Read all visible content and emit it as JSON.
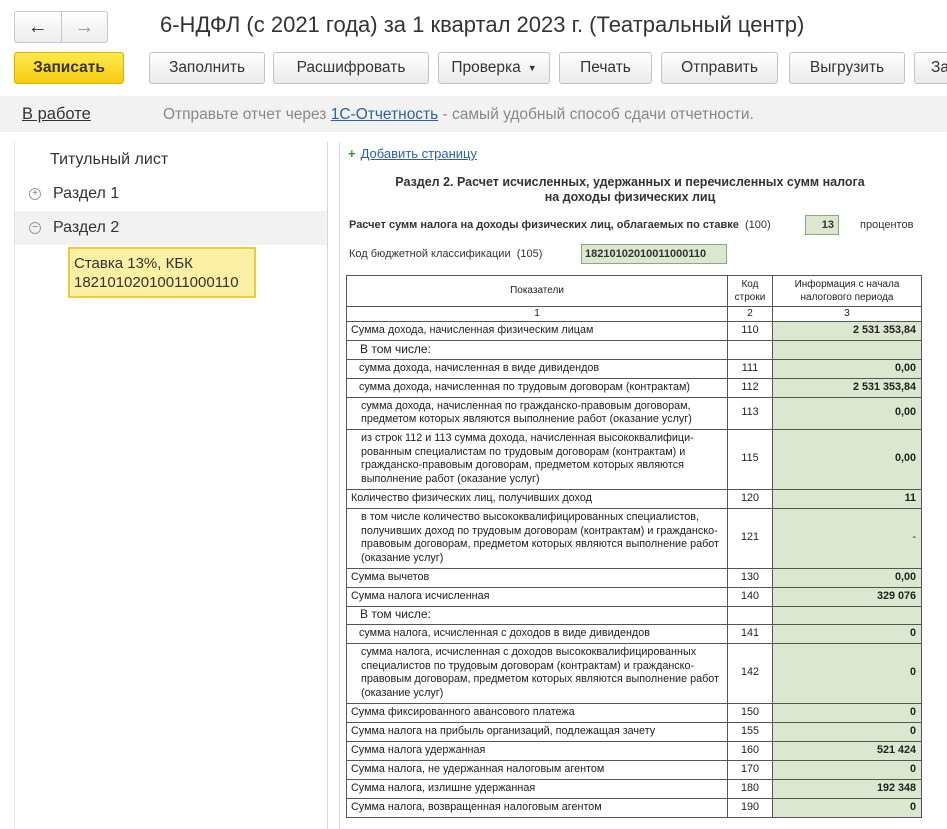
{
  "header": {
    "back_icon": "←",
    "forward_icon": "→",
    "title": "6-НДФЛ (с 2021 года) за 1 квартал 2023 г. (Театральный центр)"
  },
  "toolbar": {
    "save": "Записать",
    "fill": "Заполнить",
    "decode": "Расшифровать",
    "check": "Проверка",
    "print": "Печать",
    "send": "Отправить",
    "export": "Выгрузить",
    "more": "За",
    "dropdown_caret": "▼"
  },
  "statusbar": {
    "status": "В работе",
    "promo_before": "Отправьте отчет через ",
    "promo_link": "1С-Отчетность",
    "promo_after": " - самый удобный способ сдачи отчетности."
  },
  "tree": {
    "items": [
      {
        "label": "Титульный лист",
        "expander": ""
      },
      {
        "label": "Раздел 1",
        "expander": "+"
      },
      {
        "label": "Раздел 2",
        "expander": "−"
      }
    ],
    "sub_item": "Ставка 13%, КБК 18210102010011000110"
  },
  "report": {
    "add_page_icon": "+",
    "add_page": "Добавить страницу",
    "heading_line1": "Раздел 2. Расчет исчисленных, удержанных и перечисленных сумм налога",
    "heading_line2": "на доходы физических лиц",
    "rate_label": "Расчет сумм налога на доходы физических лиц, облагаемых по ставке",
    "rate_code": "(100)",
    "rate_value": "13",
    "rate_unit": "процентов",
    "kbk_label": "Код бюджетной классификации",
    "kbk_code": "(105)",
    "kbk_value": "18210102010011000110",
    "columns": {
      "indicators": "Показатели",
      "code_line1": "Код",
      "code_line2": "строки",
      "info_line1": "Информация с начала",
      "info_line2": "налогового периода",
      "num1": "1",
      "num2": "2",
      "num3": "3"
    },
    "rows": [
      {
        "label": "Сумма дохода, начисленная физическим лицам",
        "code": "110",
        "value": "2 531 353,84"
      },
      {
        "label": "В том числе:",
        "code": "",
        "value": ""
      },
      {
        "label": "сумма дохода, начисленная в виде дивидендов",
        "code": "111",
        "value": "0,00"
      },
      {
        "label": "сумма дохода, начисленная по трудовым договорам (контрактам)",
        "code": "112",
        "value": "2 531 353,84"
      },
      {
        "label": "сумма дохода, начисленная по гражданско-правовым договорам, предметом которых являются выполнение работ (оказание услуг)",
        "code": "113",
        "value": "0,00"
      },
      {
        "label": "из строк 112 и 113 сумма дохода, начисленная высококвалифици-рованным специалистам по трудовым договорам (контрактам) и гражданско-правовым договорам, предметом которых являются выполнение работ (оказание услуг)",
        "code": "115",
        "value": "0,00"
      },
      {
        "label": "Количество физических лиц, получивших доход",
        "code": "120",
        "value": "11"
      },
      {
        "label": "в том числе количество высококвалифицированных специалистов, получивших доход по трудовым договорам (контрактам) и гражданско-правовым договорам, предметом которых являются выполнение работ (оказание услуг)",
        "code": "121",
        "value": "-"
      },
      {
        "label": "Сумма вычетов",
        "code": "130",
        "value": "0,00"
      },
      {
        "label": "Сумма налога исчисленная",
        "code": "140",
        "value": "329 076"
      },
      {
        "label": "В том числе:",
        "code": "",
        "value": ""
      },
      {
        "label": "сумма налога, исчисленная с доходов в виде дивидендов",
        "code": "141",
        "value": "0"
      },
      {
        "label": "сумма налога, исчисленная с доходов высококвалифицированных специалистов по трудовым договорам (контрактам) и гражданско-правовым договорам, предметом которых являются выполнение работ (оказание услуг)",
        "code": "142",
        "value": "0"
      },
      {
        "label": "Сумма фиксированного авансового платежа",
        "code": "150",
        "value": "0"
      },
      {
        "label": "Сумма налога на прибыль организаций, подлежащая зачету",
        "code": "155",
        "value": "0"
      },
      {
        "label": "Сумма налога удержанная",
        "code": "160",
        "value": "521 424"
      },
      {
        "label": "Сумма налога, не удержанная налоговым агентом",
        "code": "170",
        "value": "0"
      },
      {
        "label": "Сумма налога, излишне удержанная",
        "code": "180",
        "value": "192 348"
      },
      {
        "label": "Сумма налога, возвращенная налоговым агентом",
        "code": "190",
        "value": "0"
      }
    ]
  }
}
